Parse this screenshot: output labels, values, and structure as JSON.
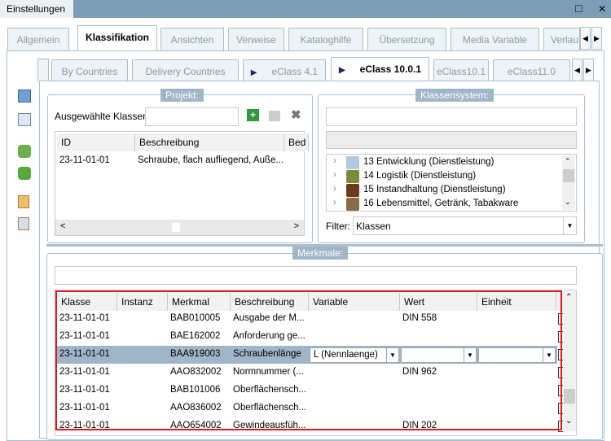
{
  "window": {
    "title": "Einstellungen",
    "maximize_icon": "□",
    "close_icon": "✕"
  },
  "main_tabs": [
    "Allgemein",
    "Klassifikation",
    "Ansichten",
    "Verweise",
    "Kataloghilfe",
    "Übersetzung",
    "Media Variable",
    "Verlauf"
  ],
  "active_main_tab": "Klassifikation",
  "sub_tabs": [
    "By Countries",
    "Delivery Countries",
    "eClass 4.1",
    "eClass 10.0.1",
    "eClass10.1",
    "eClass11.0"
  ],
  "active_sub_tab": "eClass 10.0.1",
  "projekt": {
    "title": "Projekt:",
    "selected_label": "Ausgewählte Klassen",
    "selected_value": "",
    "columns": [
      "ID",
      "Beschreibung",
      "Bed"
    ],
    "rows": [
      {
        "id": "23-11-01-01",
        "desc": "Schraube, flach aufliegend, Auße..."
      }
    ]
  },
  "klassensystem": {
    "title": "Klassensystem:",
    "search_value": "",
    "tree": [
      "13 Entwicklung (Dienstleistung)",
      "14 Logistik (Dienstleistung)",
      "15 Instandhaltung (Dienstleistung)",
      "16 Lebensmittel, Getränk, Tabakware"
    ],
    "filter_label": "Filter:",
    "filter_value": "Klassen"
  },
  "merkmale": {
    "title": "Merkmale:",
    "search_value": "",
    "columns": [
      "Klasse",
      "Instanz",
      "Merkmal",
      "Beschreibung",
      "Variable",
      "Wert",
      "Einheit"
    ],
    "rows": [
      {
        "klasse": "23-11-01-01",
        "instanz": "",
        "merkmal": "BAB010005",
        "beschreibung": "Ausgabe der M...",
        "variable": "",
        "wert": "DIN 558",
        "einheit": ""
      },
      {
        "klasse": "23-11-01-01",
        "instanz": "",
        "merkmal": "BAE162002",
        "beschreibung": "Anforderung ge...",
        "variable": "",
        "wert": "",
        "einheit": ""
      },
      {
        "klasse": "23-11-01-01",
        "instanz": "",
        "merkmal": "BAA919003",
        "beschreibung": "Schraubenlänge",
        "variable": "L (Nennlaenge)",
        "wert": "",
        "einheit": "",
        "selected": true
      },
      {
        "klasse": "23-11-01-01",
        "instanz": "",
        "merkmal": "AAO832002",
        "beschreibung": "Normnummer (...",
        "variable": "",
        "wert": "DIN 962",
        "einheit": ""
      },
      {
        "klasse": "23-11-01-01",
        "instanz": "",
        "merkmal": "BAB101006",
        "beschreibung": "Oberflächensch...",
        "variable": "",
        "wert": "",
        "einheit": ""
      },
      {
        "klasse": "23-11-01-01",
        "instanz": "",
        "merkmal": "AAO836002",
        "beschreibung": "Oberflächensch...",
        "variable": "",
        "wert": "",
        "einheit": ""
      },
      {
        "klasse": "23-11-01-01",
        "instanz": "",
        "merkmal": "AAO654002",
        "beschreibung": "Gewindeausfüh...",
        "variable": "",
        "wert": "DIN 202",
        "einheit": ""
      }
    ]
  },
  "colors": {
    "titlebar": "#7b9db5",
    "selection": "#9fb6c8",
    "highlight_border": "#e8141b"
  }
}
